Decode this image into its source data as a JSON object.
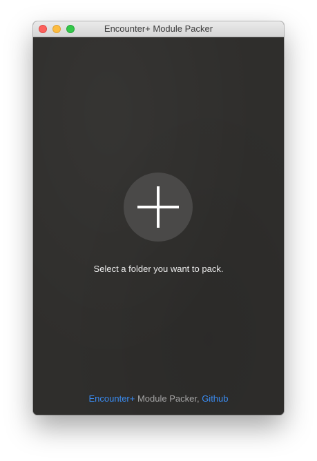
{
  "window": {
    "title": "Encounter+ Module Packer"
  },
  "main": {
    "add_icon": "plus-icon",
    "prompt": "Select a folder you want to pack."
  },
  "footer": {
    "app_link": "Encounter+",
    "text": " Module Packer, ",
    "github_link": "Github"
  },
  "colors": {
    "background": "#2f2e2c",
    "button": "#4a4948",
    "link": "#3a8bf0"
  }
}
